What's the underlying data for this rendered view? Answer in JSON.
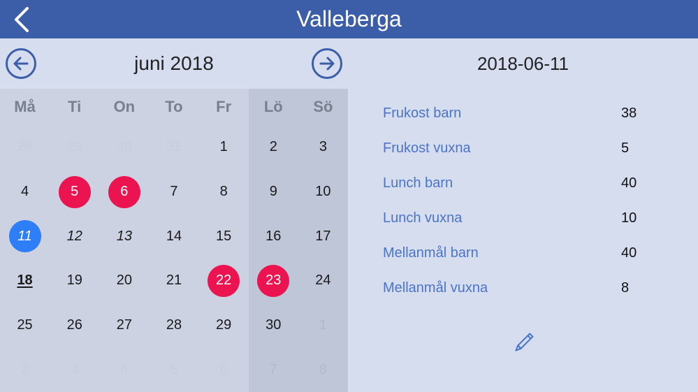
{
  "header": {
    "title": "Valleberga"
  },
  "calendar": {
    "month_label": "juni 2018",
    "weekdays": [
      "Må",
      "Ti",
      "On",
      "To",
      "Fr",
      "Lö",
      "Sö"
    ],
    "weeks": [
      [
        {
          "n": "28",
          "other": true
        },
        {
          "n": "29",
          "other": true
        },
        {
          "n": "30",
          "other": true
        },
        {
          "n": "31",
          "other": true
        },
        {
          "n": "1"
        },
        {
          "n": "2",
          "weekend": true
        },
        {
          "n": "3",
          "weekend": true
        }
      ],
      [
        {
          "n": "4"
        },
        {
          "n": "5",
          "red": true
        },
        {
          "n": "6",
          "red": true
        },
        {
          "n": "7"
        },
        {
          "n": "8"
        },
        {
          "n": "9",
          "weekend": true
        },
        {
          "n": "10",
          "weekend": true
        }
      ],
      [
        {
          "n": "11",
          "blue": true
        },
        {
          "n": "12",
          "italic": true
        },
        {
          "n": "13",
          "italic": true
        },
        {
          "n": "14"
        },
        {
          "n": "15"
        },
        {
          "n": "16",
          "weekend": true
        },
        {
          "n": "17",
          "weekend": true
        }
      ],
      [
        {
          "n": "18",
          "today": true
        },
        {
          "n": "19"
        },
        {
          "n": "20"
        },
        {
          "n": "21"
        },
        {
          "n": "22",
          "red": true
        },
        {
          "n": "23",
          "red": true,
          "weekend": true
        },
        {
          "n": "24",
          "weekend": true
        }
      ],
      [
        {
          "n": "25"
        },
        {
          "n": "26"
        },
        {
          "n": "27"
        },
        {
          "n": "28"
        },
        {
          "n": "29"
        },
        {
          "n": "30",
          "weekend": true
        },
        {
          "n": "1",
          "weekend": true,
          "other": true
        }
      ],
      [
        {
          "n": "2",
          "other": true
        },
        {
          "n": "3",
          "other": true
        },
        {
          "n": "4",
          "other": true
        },
        {
          "n": "5",
          "other": true
        },
        {
          "n": "6",
          "other": true
        },
        {
          "n": "7",
          "other": true,
          "weekend": true
        },
        {
          "n": "8",
          "other": true,
          "weekend": true
        }
      ]
    ]
  },
  "detail": {
    "date": "2018-06-11",
    "rows": [
      {
        "label": "Frukost barn",
        "value": "38"
      },
      {
        "label": "Frukost vuxna",
        "value": "5"
      },
      {
        "label": "Lunch barn",
        "value": "40"
      },
      {
        "label": "Lunch vuxna",
        "value": "10"
      },
      {
        "label": "Mellanmål barn",
        "value": "40"
      },
      {
        "label": "Mellanmål vuxna",
        "value": "8"
      }
    ]
  }
}
